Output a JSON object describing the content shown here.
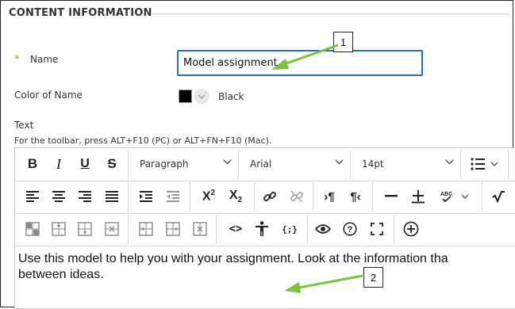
{
  "section": {
    "title": "CONTENT INFORMATION"
  },
  "name_field": {
    "required_mark": "*",
    "label": "Name",
    "value": "Model assignment"
  },
  "color_field": {
    "label": "Color of Name",
    "swatch_color": "#000000",
    "value": "Black"
  },
  "text_field": {
    "label": "Text",
    "help": "For the toolbar, press ALT+F10 (PC) or ALT+FN+F10 (Mac)."
  },
  "toolbar": {
    "paragraph_dropdown": "Paragraph",
    "font_dropdown": "Arial",
    "size_dropdown": "14pt",
    "icons": [
      "bold-icon",
      "italic-icon",
      "underline-icon",
      "strikethrough-icon",
      "bullet-list-icon",
      "align-left-icon",
      "align-center-icon",
      "align-right-icon",
      "align-justify-icon",
      "indent-icon",
      "outdent-icon",
      "superscript-icon",
      "subscript-icon",
      "link-icon",
      "unlink-icon",
      "ltr-icon",
      "rtl-icon",
      "horizontal-rule-icon",
      "plus-minus-icon",
      "spellcheck-icon",
      "math-icon",
      "table-icon",
      "insert-row-before-icon",
      "insert-row-after-icon",
      "delete-row-icon",
      "insert-col-before-icon",
      "insert-col-after-icon",
      "delete-col-icon",
      "code-icon",
      "accessibility-icon",
      "mashup-icon",
      "preview-icon",
      "help-icon",
      "fullscreen-icon",
      "add-content-icon"
    ]
  },
  "editor": {
    "line1": "Use this model to help you with your assignment. Look at the information tha",
    "line2": "between ideas."
  },
  "callouts": {
    "one": "1",
    "two": "2"
  },
  "colors": {
    "arrow": "#7cc242",
    "focus_border": "#2b6cb0",
    "required": "#d9822b"
  }
}
